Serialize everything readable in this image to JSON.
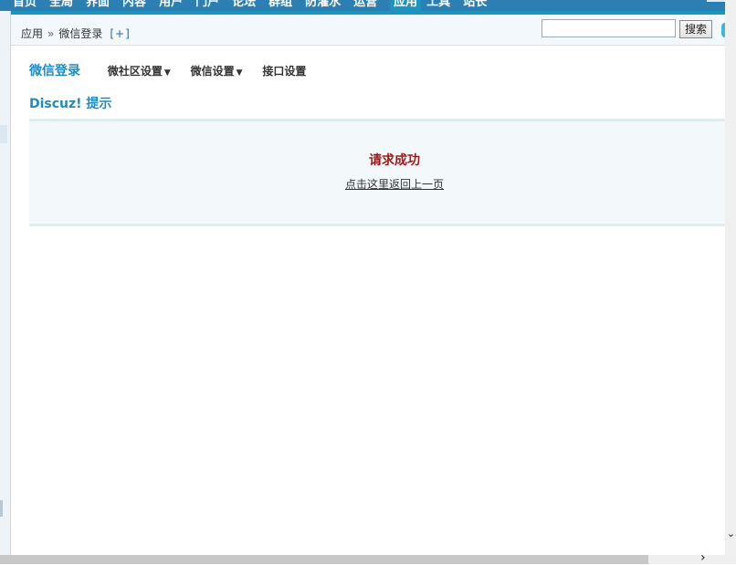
{
  "topnav": {
    "items": [
      "首页",
      "全局",
      "界面",
      "内容",
      "用户",
      "门户",
      "论坛",
      "群组",
      "防灌水",
      "运营",
      "应用",
      "工具",
      "站长"
    ],
    "active_index": 10
  },
  "breadcrumb": {
    "root": "应用",
    "separator": "»",
    "current": "微信登录",
    "add_label": "[+]"
  },
  "search": {
    "value": "",
    "button_label": "搜索"
  },
  "subnav": {
    "title": "微信登录",
    "items": [
      {
        "label": "微社区设置",
        "has_dropdown": true
      },
      {
        "label": "微信设置",
        "has_dropdown": true
      },
      {
        "label": "接口设置",
        "has_dropdown": false
      }
    ]
  },
  "tip": {
    "title": "Discuz! 提示"
  },
  "message": {
    "text": "请求成功",
    "back_link": "点击这里返回上一页"
  },
  "colors": {
    "accent": "#1f8bbf",
    "message_text": "#9b1a1a",
    "nav_bar": "#2b7fb3"
  }
}
